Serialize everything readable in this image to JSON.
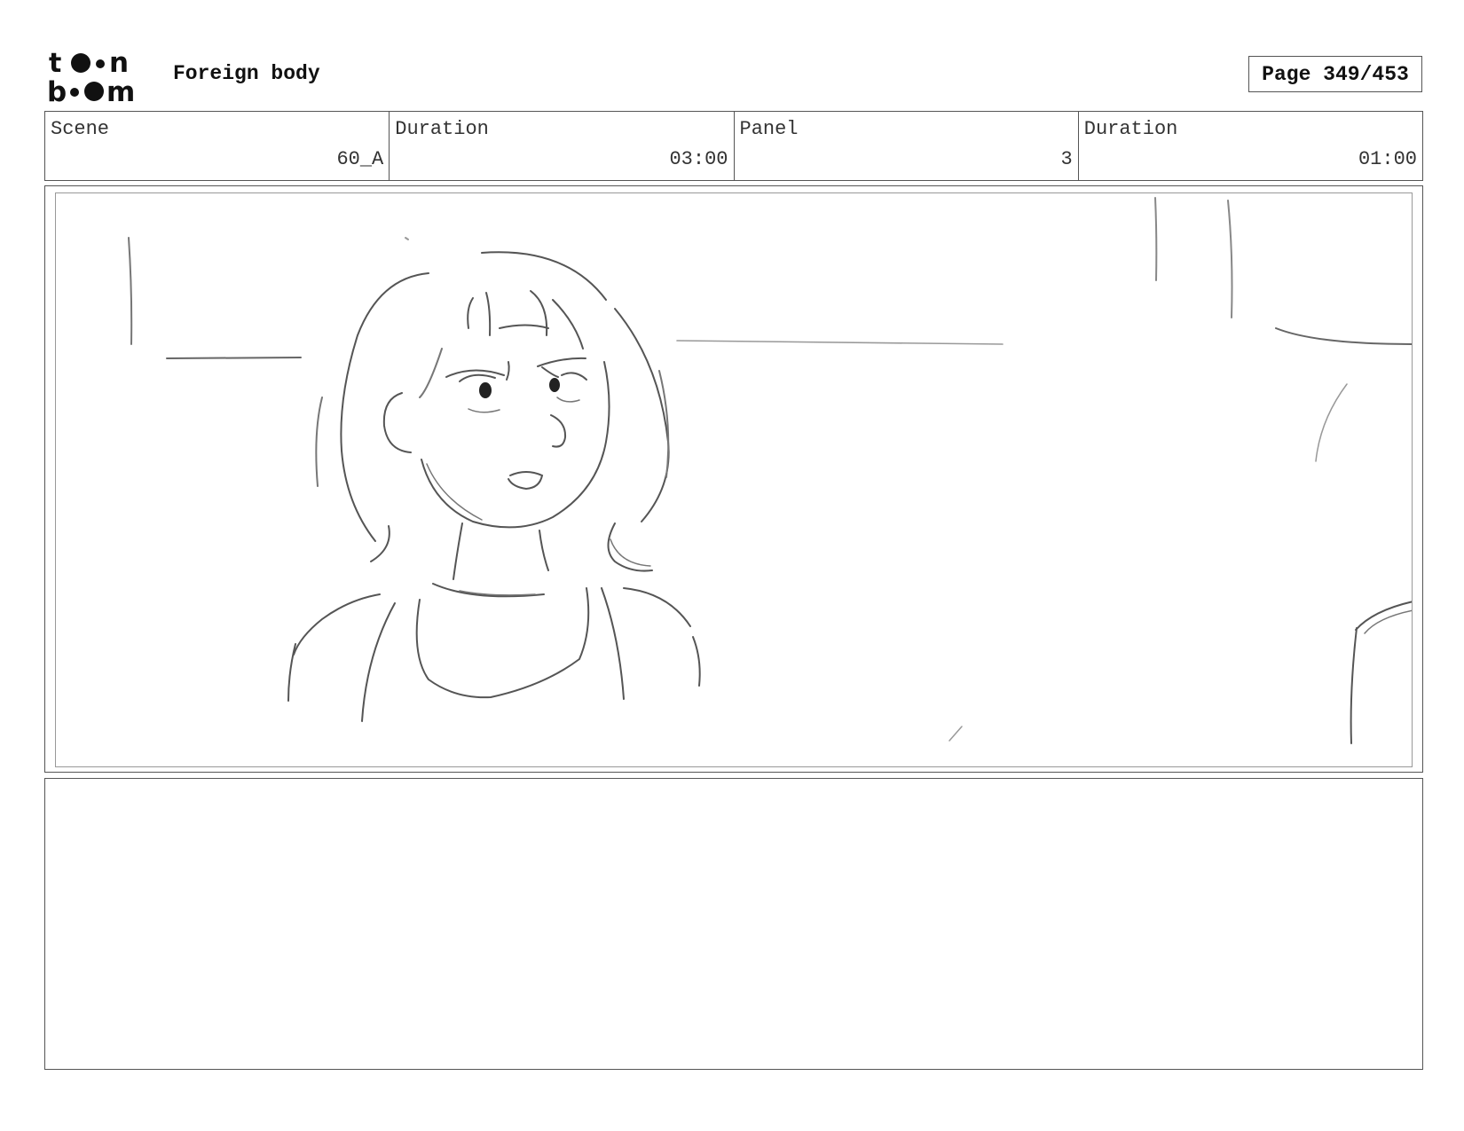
{
  "header": {
    "project_title": "Foreign body",
    "page_label": "Page 349/453"
  },
  "info": {
    "scene_label": "Scene",
    "scene_value": "60_A",
    "scene_duration_label": "Duration",
    "scene_duration_value": "03:00",
    "panel_label": "Panel",
    "panel_value": "3",
    "panel_duration_label": "Duration",
    "panel_duration_value": "01:00"
  },
  "notes": {
    "text": ""
  }
}
